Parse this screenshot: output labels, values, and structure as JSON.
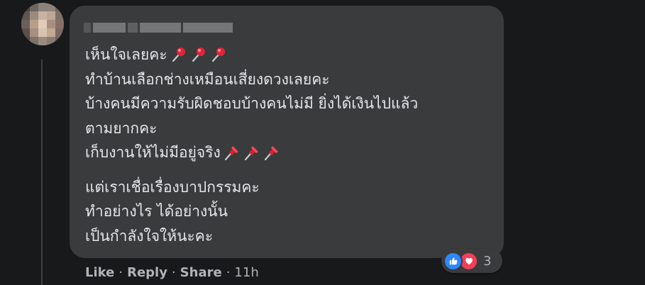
{
  "comment": {
    "author_name_blurred": "",
    "lines_part1": [
      "เห็นใจเลยคะ",
      "ทำบ้านเลือกช่างเหมือนเสี่ยงดวงเลยคะ",
      "บ้างคนมีความรับผิดชอบบ้างคนไม่มี ยิ่งได้เงินไปแล้ว",
      "ตามยากคะ",
      "เก็บงานให้ไม่มีอยู่จริง"
    ],
    "lines_part2": [
      "แต่เราเชื่อเรื่องบาปกรรมคะ",
      "ทำอย่างไร ได้อย่างนั้น",
      "เป็นกำลังใจให้นะคะ"
    ],
    "emojis": {
      "line1": [
        "round-pushpin-icon",
        "round-pushpin-icon",
        "round-pushpin-icon"
      ],
      "line5": [
        "pushpin-icon",
        "pushpin-icon",
        "pushpin-icon"
      ]
    }
  },
  "reactions": {
    "icons": [
      "like-icon",
      "love-icon"
    ],
    "count": "3",
    "like_color": "#2d88ff",
    "love_color": "#f33e58"
  },
  "actions": {
    "like_label": "Like",
    "reply_label": "Reply",
    "share_label": "Share",
    "separator": "·",
    "timestamp": "11h"
  },
  "colors": {
    "background": "#18191a",
    "bubble": "#3a3b3c",
    "text": "#e4e6eb",
    "secondary_text": "#b0b3b8"
  }
}
